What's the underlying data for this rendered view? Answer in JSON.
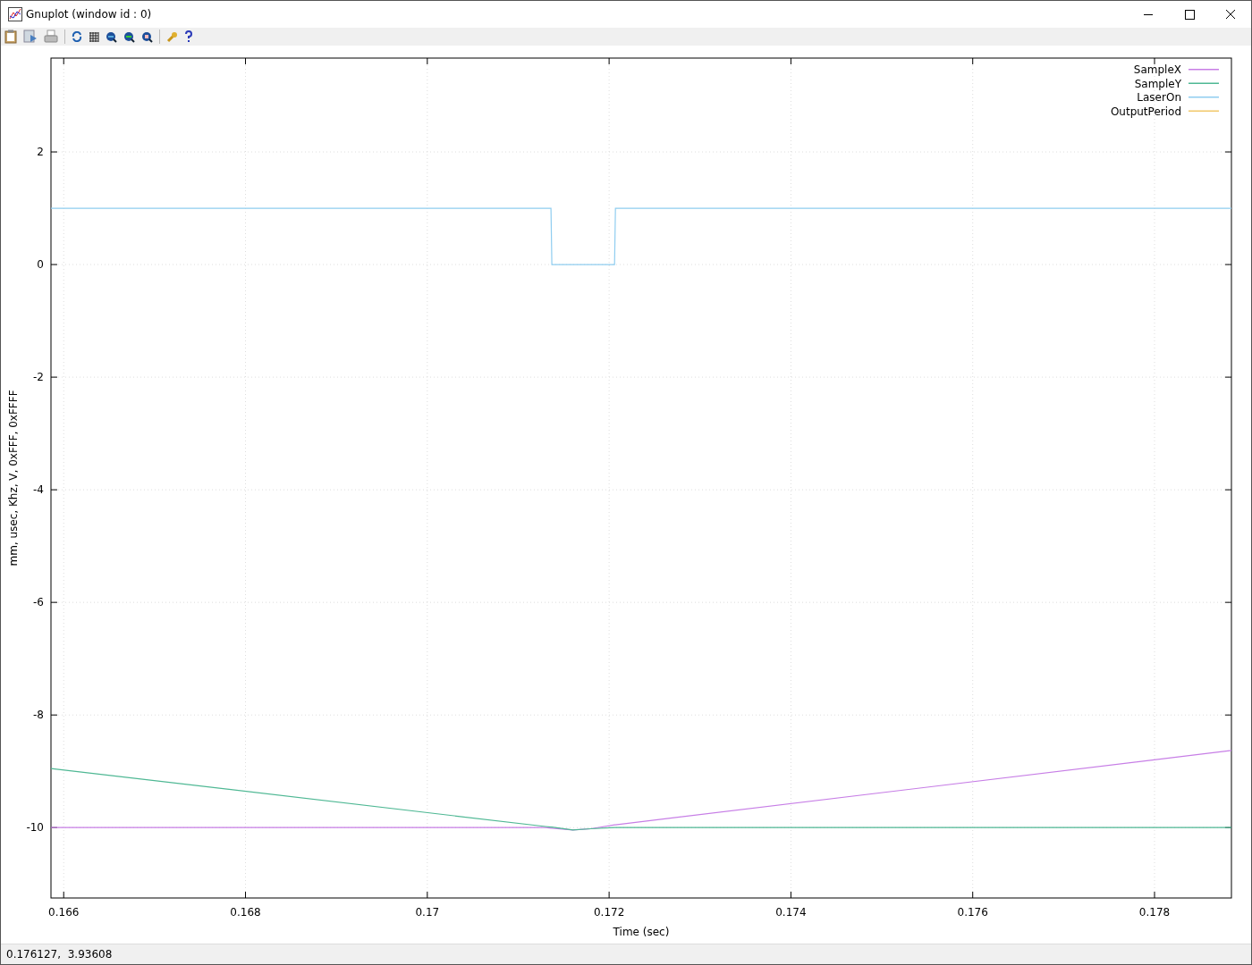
{
  "window": {
    "title": "Gnuplot (window id : 0)"
  },
  "plot": {
    "chart_data": {
      "type": "line",
      "xlabel": "Time (sec)",
      "ylabel": "mm, usec, Khz, V, 0xFFF, 0xFFFF",
      "x": [
        0.16586,
        0.1713,
        0.17136,
        0.17137,
        0.1716,
        0.1718,
        0.17206,
        0.17207,
        0.178846
      ],
      "series": [
        {
          "name": "SampleX",
          "color": "#c77ee6",
          "values": [
            -10,
            -10,
            -10.01,
            -10.01,
            -10.04,
            -10.02,
            -9.95,
            -9.95,
            -8.63
          ]
        },
        {
          "name": "SampleY",
          "color": "#4fb894",
          "values": [
            -8.95,
            -9.98,
            -9.99,
            -9.99,
            -10.04,
            -10.02,
            -10,
            -10,
            -10
          ]
        },
        {
          "name": "LaserOn",
          "color": "#8fcdf0",
          "values": [
            1,
            1,
            1,
            0,
            0,
            0,
            0,
            1,
            1
          ]
        },
        {
          "name": "OutputPeriod",
          "color": "#f2c86a",
          "values": [
            null,
            null,
            null,
            null,
            null,
            null,
            null,
            null,
            null
          ]
        }
      ],
      "xlim": [
        0.16586,
        0.178846
      ],
      "ylim": [
        -11.25,
        3.667
      ],
      "xticks": [
        0.166,
        0.168,
        0.17,
        0.172,
        0.174,
        0.176,
        0.178
      ],
      "yticks": [
        -10,
        -8,
        -6,
        -4,
        -2,
        0,
        2
      ],
      "grid": true,
      "legend": true
    }
  },
  "status_bar": {
    "text": "0.176127,  3.93608"
  }
}
